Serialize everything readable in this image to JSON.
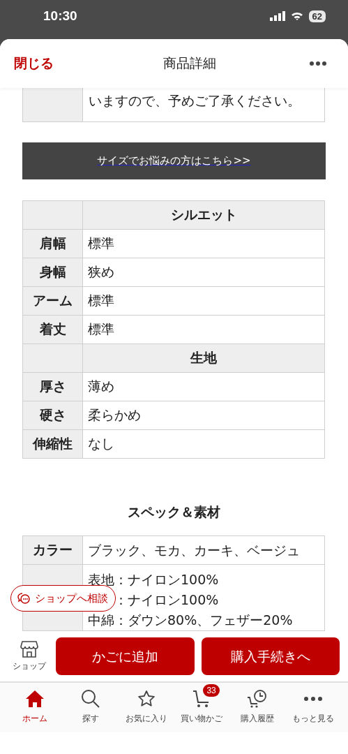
{
  "status_bar": {
    "time": "10:30",
    "battery": "62"
  },
  "header": {
    "close": "閉じる",
    "title": "商品詳細"
  },
  "note": {
    "text": "いますので、予めご了承ください。"
  },
  "size_link": "サイズでお悩みの方はこちら>>",
  "fit_table": {
    "rows": [
      {
        "kind": "heading",
        "value": "シルエット"
      },
      {
        "kind": "row",
        "label": "肩幅",
        "value": "標準"
      },
      {
        "kind": "row",
        "label": "身幅",
        "value": "狭め"
      },
      {
        "kind": "row",
        "label": "アーム",
        "value": "標準"
      },
      {
        "kind": "row",
        "label": "着丈",
        "value": "標準"
      },
      {
        "kind": "heading",
        "value": "生地"
      },
      {
        "kind": "row",
        "label": "厚さ",
        "value": "薄め"
      },
      {
        "kind": "row",
        "label": "硬さ",
        "value": "柔らかめ"
      },
      {
        "kind": "row",
        "label": "伸縮性",
        "value": "なし"
      }
    ]
  },
  "spec_title": "スペック＆素材",
  "spec_table": {
    "rows": [
      {
        "label": "カラー",
        "lines": [
          "ブラック、モカ、カーキ、ベージュ"
        ]
      },
      {
        "lines": [
          "表地：ナイロン100%",
          "：ナイロン100%",
          "中綿：ダウン80%、フェザー20%"
        ]
      }
    ]
  },
  "chat_button": "ショップへ相談",
  "actions": {
    "shop": "ショップ",
    "add_to_cart": "かごに追加",
    "checkout": "購入手続きへ"
  },
  "tabs": [
    {
      "kind": "home",
      "label": "ホーム",
      "selected": true
    },
    {
      "kind": "search",
      "label": "探す",
      "selected": false
    },
    {
      "kind": "star",
      "label": "お気に入り",
      "selected": false
    },
    {
      "kind": "cart",
      "label": "買い物かご",
      "selected": false,
      "badge": "33"
    },
    {
      "kind": "history",
      "label": "購入履歴",
      "selected": false
    },
    {
      "kind": "more",
      "label": "もっと見る",
      "selected": false
    }
  ]
}
